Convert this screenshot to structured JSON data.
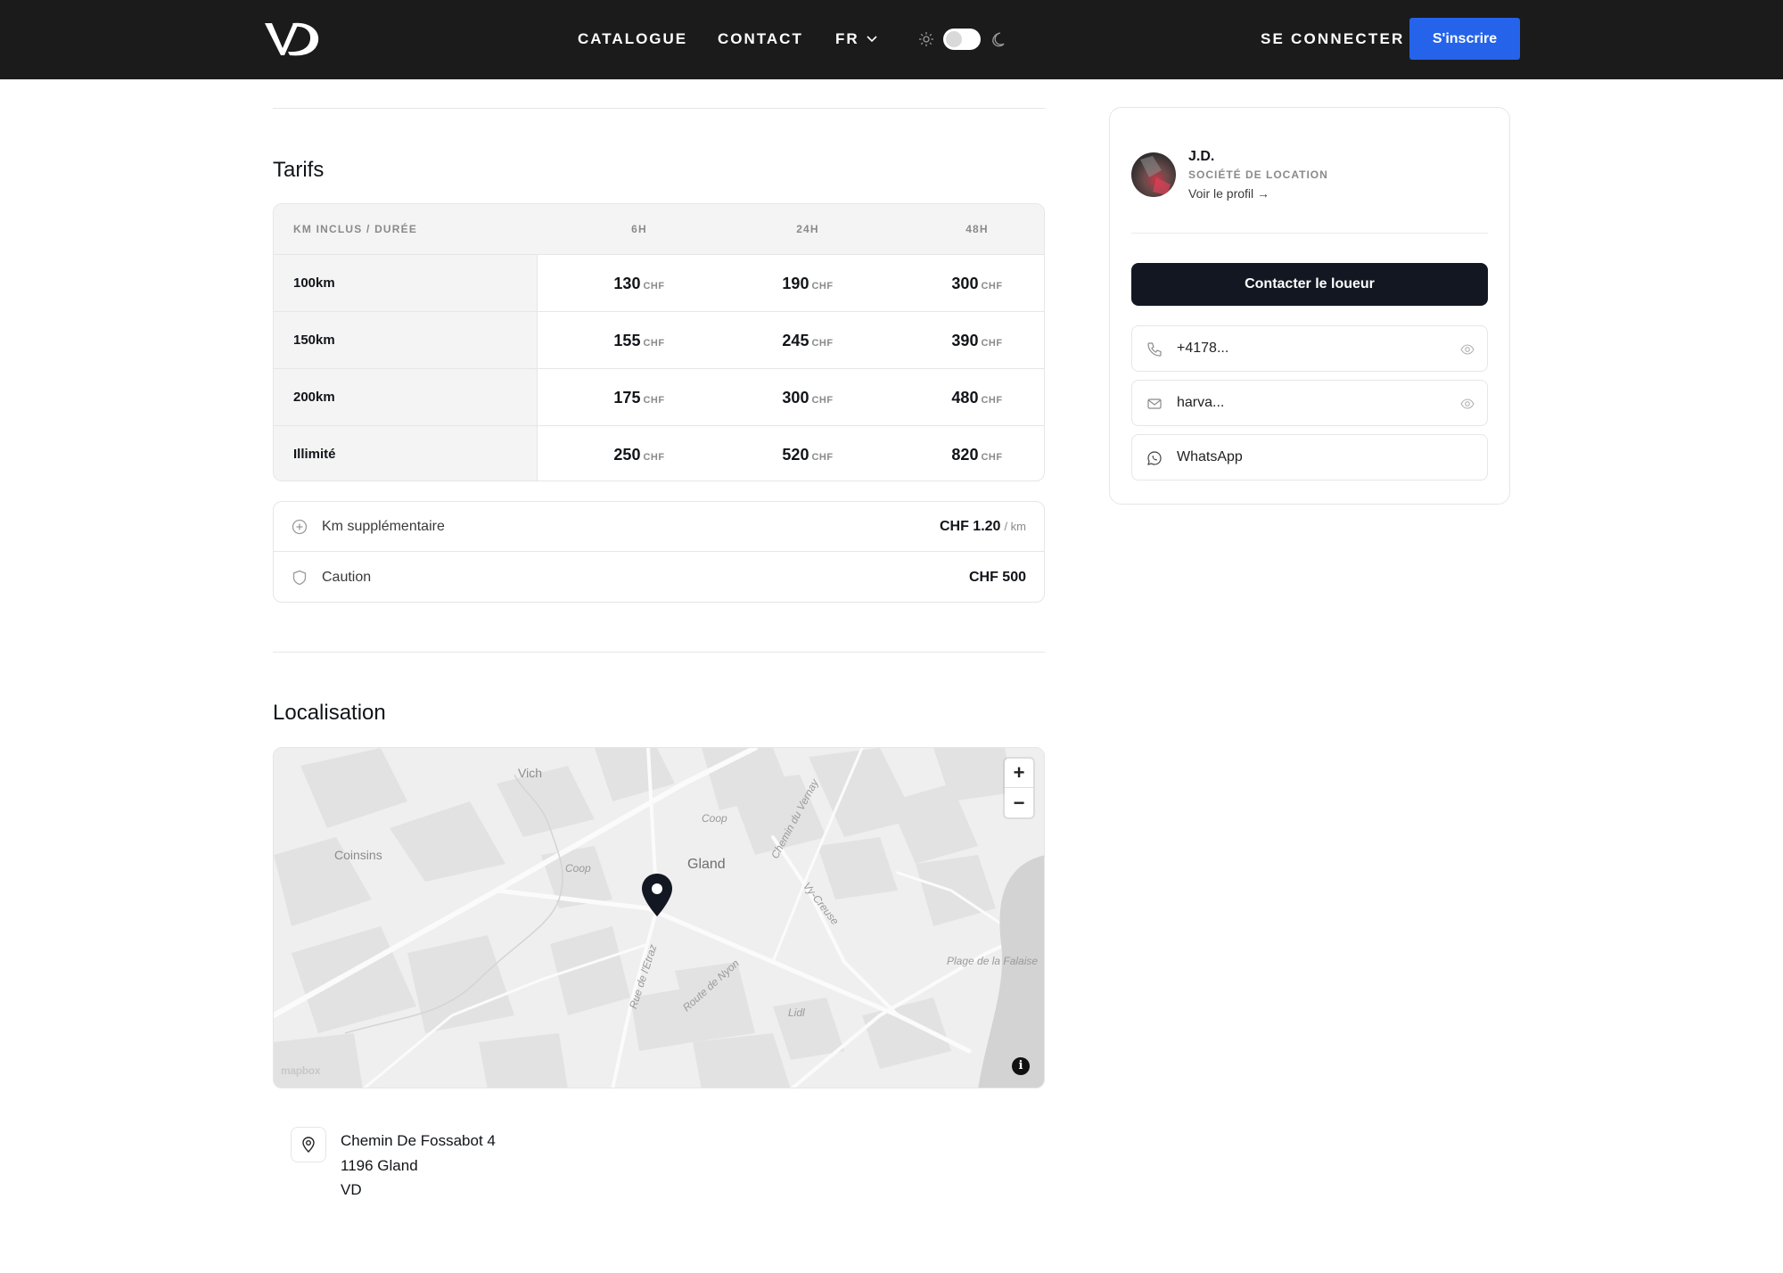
{
  "navbar": {
    "logo_text": "VD",
    "links": {
      "catalogue": "CATALOGUE",
      "contact": "CONTACT",
      "language": "FR"
    },
    "login": "SE CONNECTER",
    "signup": "S'inscrire",
    "colors": {
      "background": "#1b1b1c",
      "signup": "#2563eb"
    }
  },
  "tarifs": {
    "title": "Tarifs",
    "header": {
      "label": "KM INCLUS / DURÉE",
      "durations": [
        "6H",
        "24H",
        "48H"
      ]
    },
    "currency": "CHF",
    "rows": [
      {
        "label": "100km",
        "values": [
          "130",
          "190",
          "300"
        ]
      },
      {
        "label": "150km",
        "values": [
          "155",
          "245",
          "390"
        ]
      },
      {
        "label": "200km",
        "values": [
          "175",
          "300",
          "480"
        ]
      },
      {
        "label": "Illimité",
        "values": [
          "250",
          "520",
          "820"
        ]
      }
    ],
    "extras": {
      "extra_km": {
        "label": "Km supplémentaire",
        "value": "CHF 1.20",
        "unit": "/ km"
      },
      "deposit": {
        "label": "Caution",
        "value": "CHF 500"
      }
    }
  },
  "location": {
    "title": "Localisation",
    "map": {
      "labels": {
        "vich": "Vich",
        "coinsins": "Coinsins",
        "gland": "Gland",
        "coop_1": "Coop",
        "coop_2": "Coop",
        "lidl": "Lidl",
        "chemin_vernay": "Chemin du Vernay",
        "vy_creuse": "Vy-Creuse",
        "rue_etraz": "Rue de l'Etraz",
        "route_nyon": "Route de Nyon",
        "plage": "Plage de la Falaise"
      },
      "zoom_in": "+",
      "zoom_out": "−",
      "attribution": "mapbox",
      "info": "i"
    },
    "address": {
      "line1": "Chemin De Fossabot 4",
      "line2": "1196 Gland",
      "line3": "VD"
    }
  },
  "owner_card": {
    "name": "J.D.",
    "type": "SOCIÉTÉ DE LOCATION",
    "profile_link": "Voir le profil →",
    "contact_button": "Contacter le loueur",
    "phone": "+4178...",
    "email": "harva...",
    "whatsapp": "WhatsApp",
    "colors": {
      "contact_button": "#131722"
    }
  }
}
